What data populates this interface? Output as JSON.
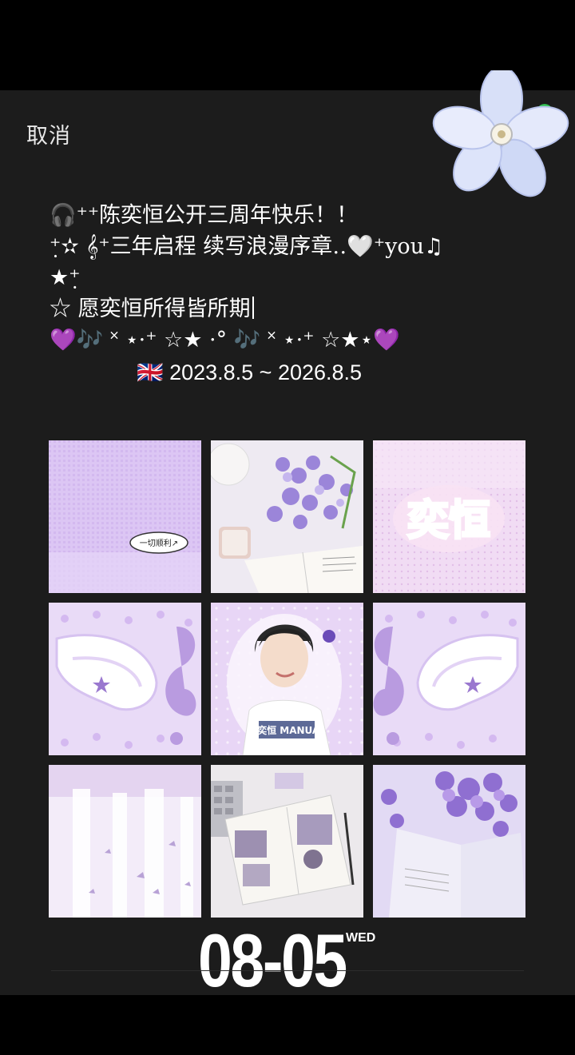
{
  "cancel_label": "取消",
  "caption": {
    "line1": "🎧⁺⁺陈奕恒公开三周年快乐！！",
    "line2": "⁺̣✫ 𝄞⁺三年启程 续写浪漫序章‥🤍⁺you♫",
    "line3": "★⁺̣",
    "line4": "☆ 愿奕恒所得皆所期",
    "line5": "💜🎶 ˟ ⋆·⁺ ☆★ ·° 🎶 ˟ ⋆·⁺ ☆★⋆💜",
    "line6": "🇬🇧  2023.8.5 ~ 2026.8.5"
  },
  "photos": [
    {
      "name": "photo-lavender-note",
      "caption": "一切顺利↗"
    },
    {
      "name": "photo-flowers-book"
    },
    {
      "name": "photo-yiheng-logo",
      "caption": "奕恒"
    },
    {
      "name": "photo-wing-clef-left"
    },
    {
      "name": "photo-boy-portrait",
      "caption": "陈奕恒 MANUAL"
    },
    {
      "name": "photo-wing-clef-right"
    },
    {
      "name": "photo-butterfly-curtain"
    },
    {
      "name": "photo-journal-desk"
    },
    {
      "name": "photo-wisteria-book"
    }
  ],
  "footer": {
    "date": "08-05",
    "weekday": "WED"
  },
  "colors": {
    "panel": "#1c1c1c",
    "lavender": "#d9c4f2",
    "purple": "#9b6fd6"
  }
}
